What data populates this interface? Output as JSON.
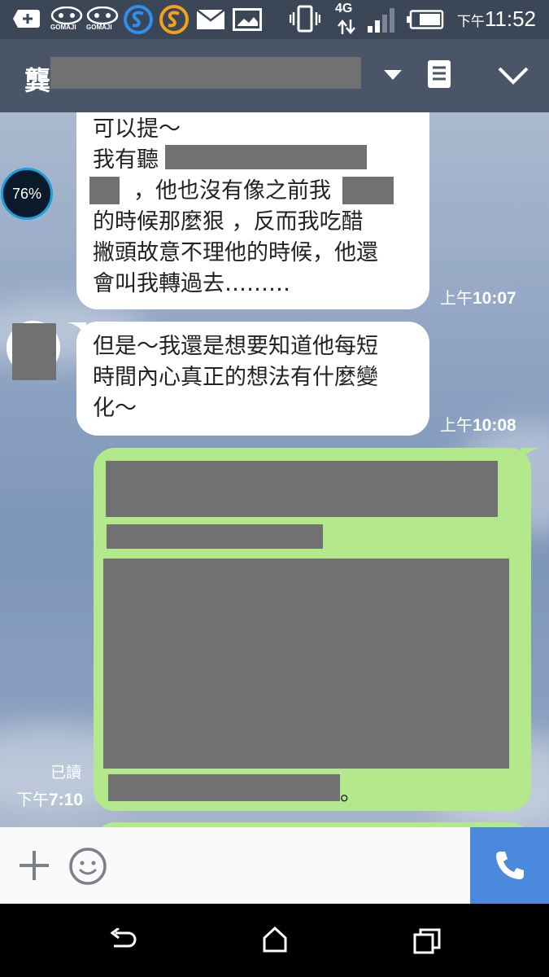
{
  "status_bar": {
    "network": "4G",
    "ampm": "下午",
    "time": "11:52",
    "app_icons": [
      "plus-icon",
      "gomaji-icon",
      "gomaji-icon",
      "s-app-blue-icon",
      "s-app-orange-icon",
      "mail-icon",
      "image-icon"
    ],
    "gomaji_label": "GOMAJI"
  },
  "header": {
    "title_visible_char": "龔",
    "icons": [
      "dropdown-arrow-icon",
      "notes-icon",
      "chevron-down-icon"
    ]
  },
  "messages": [
    {
      "side": "left",
      "lines": [
        "可以提～",
        "我有聽",
        "，他也沒有像之前我",
        "的時候那麼狠 ，反而我吃醋",
        "撇頭故意不理他的時候，他還",
        "會叫我轉過去………"
      ],
      "time_ampm": "上午",
      "time": "10:07",
      "avatar_text": "76%"
    },
    {
      "side": "left",
      "lines": [
        "但是～我還是想要知道他每短",
        "時間內心真正的想法有什麼變",
        "化～"
      ],
      "time_ampm": "上午",
      "time": "10:08"
    },
    {
      "side": "right",
      "read_label": "已讀",
      "time_ampm": "下午",
      "time": "7:10",
      "trailing_char": "。"
    }
  ],
  "input_bar": {
    "icons": [
      "plus-icon",
      "emoji-icon",
      "phone-icon"
    ]
  },
  "nav_bar": {
    "icons": [
      "back-icon",
      "home-icon",
      "recent-apps-icon"
    ]
  }
}
